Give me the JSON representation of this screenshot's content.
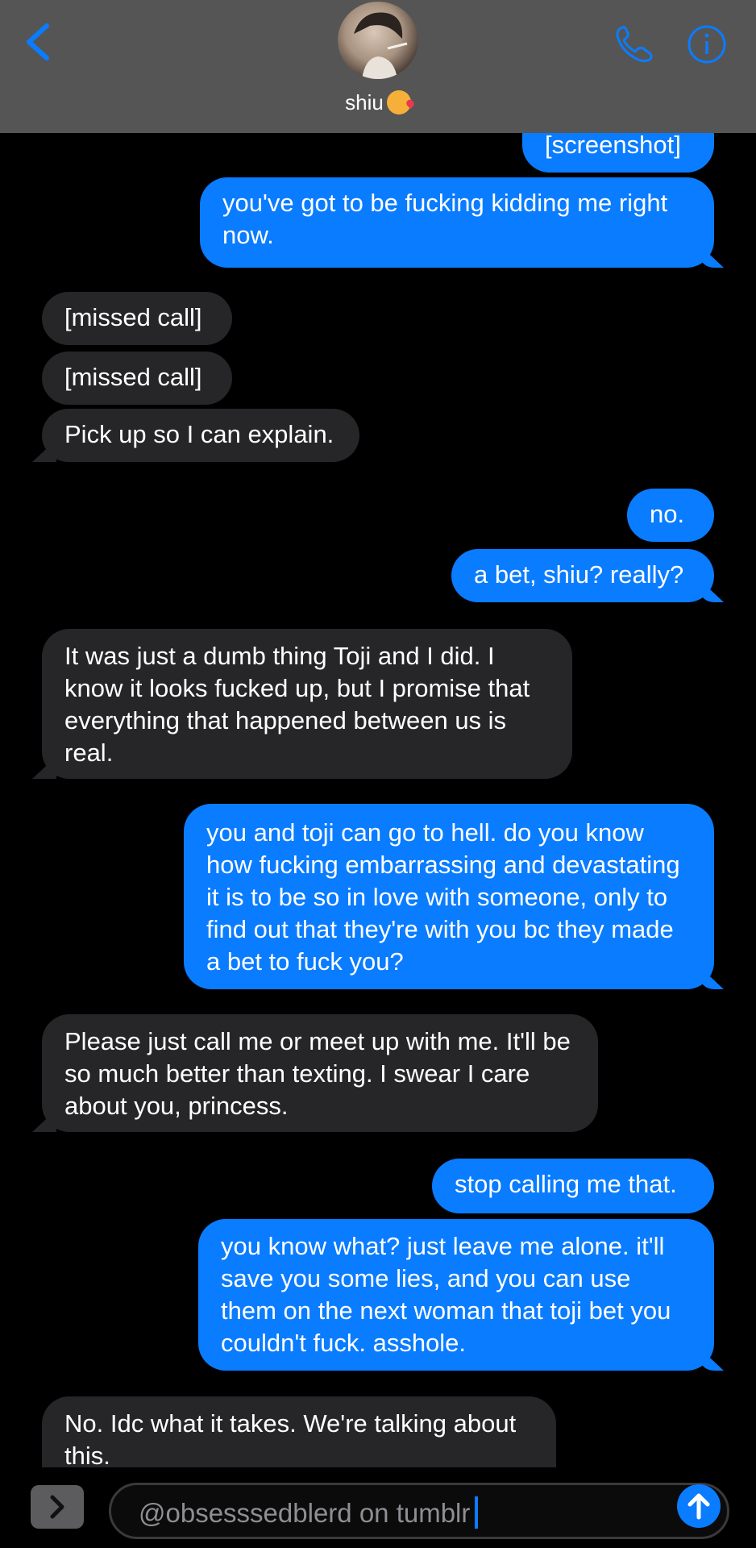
{
  "header": {
    "contact_name": "shiu",
    "avatar_icon": "avatar-image",
    "back_icon": "chevron-left-icon",
    "call_icon": "phone-icon",
    "info_icon": "info-icon",
    "accent_color": "#0a7cff"
  },
  "messages": [
    {
      "from": "me",
      "text": "[screenshot]"
    },
    {
      "from": "me",
      "text": "you've got to be fucking kidding me right now."
    },
    {
      "from": "them",
      "text": "[missed call]"
    },
    {
      "from": "them",
      "text": "[missed call]"
    },
    {
      "from": "them",
      "text": "Pick up so I can explain."
    },
    {
      "from": "me",
      "text": "no."
    },
    {
      "from": "me",
      "text": "a bet, shiu? really?"
    },
    {
      "from": "them",
      "text": "It was just a dumb thing Toji and I did. I know it looks fucked up, but I promise that everything that happened between us is real."
    },
    {
      "from": "me",
      "text": "you and toji can go to hell. do you know how fucking embarrassing and devastating it is to be so in love with someone, only to find out that they're with you bc they made a bet to fuck you?"
    },
    {
      "from": "them",
      "text": "Please just call me or meet up with me. It'll be so much better than texting. I swear I care about you, princess."
    },
    {
      "from": "me",
      "text": "stop calling me that."
    },
    {
      "from": "me",
      "text": "you know what? just leave me alone. it'll save you some lies, and you can use them on the next woman that toji bet you couldn't fuck. asshole."
    },
    {
      "from": "them",
      "text": "No. Idc what it takes. We're talking about this."
    }
  ],
  "composer": {
    "input_value": "@obsesssedblerd on tumblr",
    "expand_icon": "chevron-right-icon",
    "send_icon": "arrow-up-icon"
  }
}
